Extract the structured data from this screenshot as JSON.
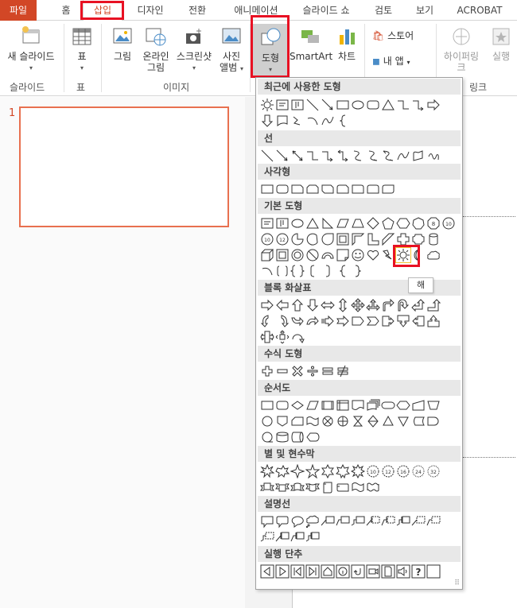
{
  "tabs": {
    "file": "파일",
    "home": "홈",
    "insert": "삽입",
    "design": "디자인",
    "transitions": "전환",
    "animations": "애니메이션",
    "slideshow": "슬라이드 쇼",
    "review": "검토",
    "view": "보기",
    "acrobat": "ACROBAT"
  },
  "ribbon": {
    "new_slide": "새 슬라이드",
    "table": "표",
    "picture": "그림",
    "online_picture_1": "온라인",
    "online_picture_2": "그림",
    "screenshot": "스크린샷",
    "photo_album_1": "사진",
    "photo_album_2": "앨범",
    "shapes": "도형",
    "smartart": "SmartArt",
    "chart": "차트",
    "store": "스토어",
    "my_apps": "내 앱",
    "hyperlink": "하이퍼링크",
    "action": "실행",
    "groups": {
      "slides": "슬라이드",
      "tables": "표",
      "images": "이미지",
      "links": "링크"
    }
  },
  "slides": {
    "number": "1"
  },
  "gallery": {
    "sections": {
      "recent": "최근에 사용한 도형",
      "lines": "선",
      "rectangles": "사각형",
      "basic": "기본 도형",
      "block_arrows": "블록 화살표",
      "equation": "수식 도형",
      "flowchart": "순서도",
      "stars": "별 및 현수막",
      "callouts": "설명선",
      "action_buttons": "실행 단추"
    },
    "tooltip": "해"
  },
  "colors": {
    "accent": "#d24726",
    "highlight": "#e81123"
  }
}
